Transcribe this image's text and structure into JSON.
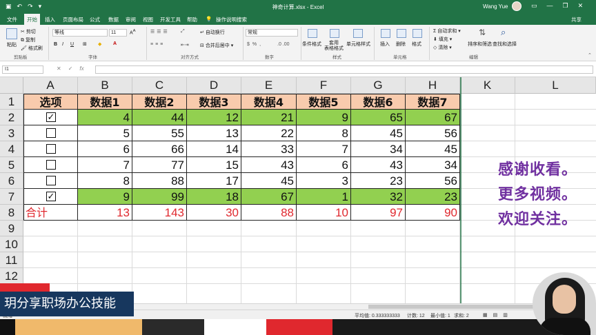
{
  "titlebar": {
    "document_title": "神奇计算.xlsx  -  Excel",
    "user_name": "Wang Yue",
    "qat_icons": [
      "save-icon",
      "undo-icon",
      "redo-icon",
      "customize-icon"
    ],
    "window_buttons": [
      "ribbon-options-icon",
      "minimize-icon",
      "restore-icon",
      "close-icon"
    ]
  },
  "tabs": {
    "items": [
      "文件",
      "开始",
      "插入",
      "页面布局",
      "公式",
      "数据",
      "审阅",
      "视图",
      "开发工具",
      "帮助"
    ],
    "active": "开始",
    "tell_me": "操作说明搜索",
    "share": "共享"
  },
  "ribbon": {
    "clipboard": {
      "paste": "粘贴",
      "cut": "剪切",
      "copy": "复制",
      "format_painter": "格式刷",
      "group": "剪贴板"
    },
    "font": {
      "name": "等线",
      "size": "11",
      "bold": "B",
      "italic": "I",
      "underline": "U",
      "group": "字体"
    },
    "alignment": {
      "wrap": "自动换行",
      "merge": "合并后居中",
      "group": "对齐方式"
    },
    "number": {
      "format": "常规",
      "group": "数字"
    },
    "styles": {
      "conditional": "条件格式",
      "table": "套用\n表格格式",
      "cell_styles": "单元格样式",
      "group": "样式"
    },
    "cells": {
      "insert": "插入",
      "delete": "删除",
      "format": "格式",
      "group": "单元格"
    },
    "editing": {
      "autosum": "自动求和",
      "fill": "填充",
      "clear": "清除",
      "sort": "排序和筛选",
      "find": "查找和选择",
      "group": "编辑"
    }
  },
  "formula_bar": {
    "name_box": "I1",
    "cancel": "✕",
    "enter": "✓",
    "fx": "fx",
    "content": ""
  },
  "sheet": {
    "columns": [
      "A",
      "B",
      "C",
      "D",
      "E",
      "F",
      "G",
      "H",
      "K",
      "L"
    ],
    "rows": [
      "1",
      "2",
      "3",
      "4",
      "5",
      "6",
      "7",
      "8",
      "9",
      "10",
      "11",
      "12"
    ],
    "headers": [
      "选项",
      "数据1",
      "数据2",
      "数据3",
      "数据4",
      "数据5",
      "数据6",
      "数据7"
    ],
    "data_rows": [
      {
        "checked": true,
        "values": [
          "4",
          "44",
          "12",
          "21",
          "9",
          "65",
          "67"
        ]
      },
      {
        "checked": false,
        "values": [
          "5",
          "55",
          "13",
          "22",
          "8",
          "45",
          "56"
        ]
      },
      {
        "checked": false,
        "values": [
          "6",
          "66",
          "14",
          "33",
          "7",
          "34",
          "45"
        ]
      },
      {
        "checked": false,
        "values": [
          "7",
          "77",
          "15",
          "43",
          "6",
          "43",
          "34"
        ]
      },
      {
        "checked": false,
        "values": [
          "8",
          "88",
          "17",
          "45",
          "3",
          "23",
          "56"
        ]
      },
      {
        "checked": true,
        "values": [
          "9",
          "99",
          "18",
          "67",
          "1",
          "32",
          "23"
        ]
      }
    ],
    "total_label": "合计",
    "totals": [
      "13",
      "143",
      "30",
      "88",
      "10",
      "97",
      "90"
    ],
    "colors": {
      "header_fill": "#f8cbad",
      "checked_fill": "#92d050",
      "total_text": "#e0282e"
    }
  },
  "overlay": {
    "lines": [
      "感谢收看。",
      "更多视频。",
      "欢迎关注。"
    ],
    "channel": "玥分享职场办公技能",
    "color": "#7030a0"
  },
  "statusbar": {
    "mode": "就绪",
    "average": "平均值: 0.333333333",
    "count": "计数: 12",
    "min": "最小值: 1",
    "sum": "求和: 2"
  }
}
